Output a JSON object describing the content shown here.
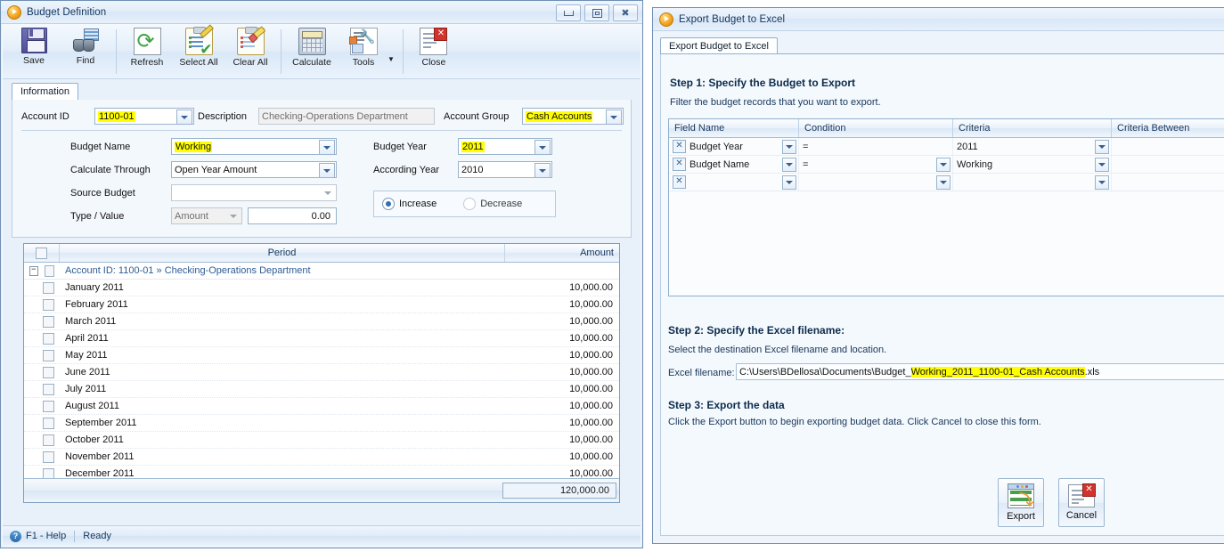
{
  "budget_window": {
    "title": "Budget Definition",
    "titlebar_buttons": [
      "minimize",
      "maximize",
      "close"
    ],
    "toolbar": [
      {
        "label": "Save",
        "icon": "floppy-disk-icon"
      },
      {
        "label": "Find",
        "icon": "binoculars-icon"
      },
      {
        "label": "Refresh",
        "icon": "refresh-arrows-icon"
      },
      {
        "label": "Select All",
        "icon": "clipboard-check-icon"
      },
      {
        "label": "Clear All",
        "icon": "clipboard-eraser-icon"
      },
      {
        "label": "Calculate",
        "icon": "calculator-icon"
      },
      {
        "label": "Tools",
        "icon": "tools-wrench-icon"
      },
      {
        "label": "Close",
        "icon": "window-close-icon"
      }
    ],
    "tab": "Information",
    "form": {
      "account_id_label": "Account ID",
      "account_id_value": "1100-01",
      "description_label": "Description",
      "description_value": "Checking-Operations Department",
      "account_group_label": "Account Group",
      "account_group_value": "Cash Accounts",
      "budget_name_label": "Budget Name",
      "budget_name_value": "Working",
      "calculate_through_label": "Calculate Through",
      "calculate_through_value": "Open Year Amount",
      "source_budget_label": "Source Budget",
      "source_budget_value": "",
      "type_value_label": "Type / Value",
      "type_value": "Amount",
      "value_amount": "0.00",
      "budget_year_label": "Budget Year",
      "budget_year_value": "2011",
      "according_year_label": "According Year",
      "according_year_value": "2010",
      "increase_label": "Increase",
      "decrease_label": "Decrease",
      "direction_selected": "Increase"
    },
    "grid": {
      "columns": [
        "Period",
        "Amount"
      ],
      "group_row": "Account ID: 1100-01 » Checking-Operations Department",
      "rows": [
        {
          "period": "January 2011",
          "amount": "10,000.00"
        },
        {
          "period": "February 2011",
          "amount": "10,000.00"
        },
        {
          "period": "March 2011",
          "amount": "10,000.00"
        },
        {
          "period": "April 2011",
          "amount": "10,000.00"
        },
        {
          "period": "May 2011",
          "amount": "10,000.00"
        },
        {
          "period": "June 2011",
          "amount": "10,000.00"
        },
        {
          "period": "July 2011",
          "amount": "10,000.00"
        },
        {
          "period": "August 2011",
          "amount": "10,000.00"
        },
        {
          "period": "September 2011",
          "amount": "10,000.00"
        },
        {
          "period": "October 2011",
          "amount": "10,000.00"
        },
        {
          "period": "November 2011",
          "amount": "10,000.00"
        },
        {
          "period": "December 2011",
          "amount": "10,000.00"
        }
      ],
      "total": "120,000.00"
    },
    "statusbar": {
      "help": "F1 - Help",
      "state": "Ready"
    }
  },
  "export_window": {
    "title": "Export Budget to Excel",
    "tab": "Export Budget to Excel",
    "step1": {
      "heading": "Step 1: Specify the Budget to Export",
      "text": "Filter the budget records that you want to export.",
      "columns": [
        "Field Name",
        "Condition",
        "Criteria",
        "Criteria Between"
      ],
      "rows": [
        {
          "field": "Budget Year",
          "condition": "=",
          "criteria": "2011",
          "between": ""
        },
        {
          "field": "Budget Name",
          "condition": "=",
          "criteria": "Working",
          "between": ""
        },
        {
          "field": "",
          "condition": "",
          "criteria": "",
          "between": ""
        }
      ]
    },
    "step2": {
      "heading": "Step 2: Specify the Excel filename:",
      "text": "Select the destination Excel filename and location.",
      "field_label": "Excel filename:",
      "filename_prefix": "C:\\Users\\BDellosa\\Documents\\Budget_",
      "filename_highlight": "Working_2011_1100-01_Cash Accounts",
      "filename_suffix": ".xls"
    },
    "step3": {
      "heading": "Step 3: Export the data",
      "text": "Click the Export button to begin exporting budget data. Click Cancel to close this form.",
      "export_label": "Export",
      "cancel_label": "Cancel"
    }
  },
  "colors": {
    "highlight": "#ffff00",
    "accent": "#2c6fb5",
    "title_text": "#14365c"
  }
}
